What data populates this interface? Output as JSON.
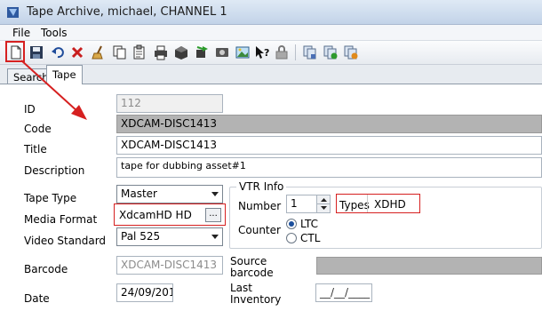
{
  "window": {
    "title": "Tape Archive, michael, CHANNEL 1"
  },
  "menu": {
    "items": [
      "File",
      "Tools"
    ]
  },
  "toolbar": {
    "buttons": [
      "new-document",
      "save",
      "undo",
      "delete",
      "broom",
      "copy",
      "paste",
      "print",
      "archive",
      "transfer",
      "image",
      "help",
      "lock",
      "copy-doc",
      "add-doc",
      "remove-doc"
    ]
  },
  "tabs": [
    "Search",
    "Tape"
  ],
  "active_tab": "Tape",
  "form": {
    "id": {
      "label": "ID",
      "value": "112"
    },
    "code": {
      "label": "Code",
      "value": "XDCAM-DISC1413"
    },
    "title": {
      "label": "Title",
      "value": "XDCAM-DISC1413"
    },
    "description": {
      "label": "Description",
      "value": "tape for dubbing asset#1"
    },
    "tape_type": {
      "label": "Tape Type",
      "value": "Master"
    },
    "media_format": {
      "label": "Media Format",
      "value": "XdcamHD HD",
      "button": "..."
    },
    "video_standard": {
      "label": "Video Standard",
      "value": "Pal 525"
    },
    "barcode": {
      "label": "Barcode",
      "value": "XDCAM-DISC1413"
    },
    "date": {
      "label": "Date",
      "value": "24/09/2012"
    },
    "source_barcode": {
      "label_line1": "Source",
      "label_line2": "barcode",
      "value": ""
    },
    "last_inventory": {
      "label_line1": "Last",
      "label_line2": "Inventory",
      "value": "__/__/____"
    }
  },
  "vtr_info": {
    "legend": "VTR Info",
    "number": {
      "label": "Number",
      "value": "1"
    },
    "types": {
      "label": "Types",
      "value": "XDHD"
    },
    "counter": {
      "label": "Counter",
      "options": [
        "LTC",
        "CTL"
      ],
      "selected": "LTC"
    }
  },
  "colors": {
    "annotation": "#d62020",
    "window_chrome": "#c9d6e6"
  }
}
